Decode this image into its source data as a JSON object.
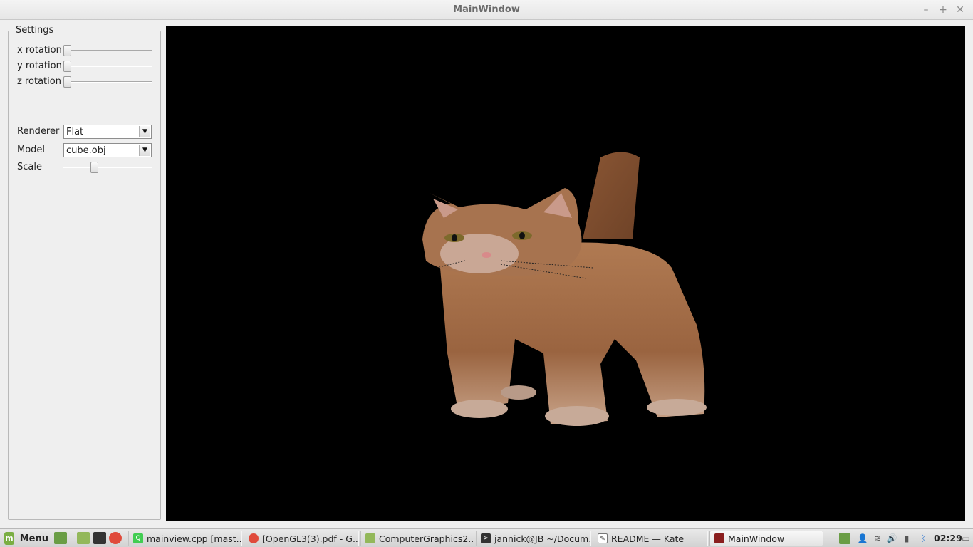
{
  "window": {
    "title": "MainWindow",
    "minimize_glyph": "–",
    "maximize_glyph": "+",
    "close_glyph": "✕"
  },
  "settings": {
    "legend": "Settings",
    "x_rotation": {
      "label": "x rotation",
      "value": 0
    },
    "y_rotation": {
      "label": "y rotation",
      "value": 0
    },
    "z_rotation": {
      "label": "z rotation",
      "value": 0
    },
    "renderer": {
      "label": "Renderer",
      "value": "Flat"
    },
    "model": {
      "label": "Model",
      "value": "cube.obj"
    },
    "scale": {
      "label": "Scale",
      "value_fraction": 0.34
    }
  },
  "viewport": {
    "background": "#000000",
    "content": "3d-rendered-cat-model"
  },
  "taskbar": {
    "menu_label": "Menu",
    "tasks": [
      {
        "label": "mainview.cpp [mast...",
        "icon": "qt-creator-icon"
      },
      {
        "label": "[OpenGL3(3).pdf - G...",
        "icon": "chrome-icon"
      },
      {
        "label": "ComputerGraphics2...",
        "icon": "folder-icon"
      },
      {
        "label": "jannick@JB ~/Docum...",
        "icon": "terminal-icon"
      },
      {
        "label": "README  — Kate",
        "icon": "kate-icon"
      },
      {
        "label": "MainWindow",
        "icon": "app-window-icon",
        "active": true
      }
    ],
    "clock": "02:29"
  },
  "colors": {
    "titlebar": "#eeeeee",
    "window_bg": "#efefef",
    "viewport_bg": "#000000",
    "mint_green": "#7aae42"
  }
}
